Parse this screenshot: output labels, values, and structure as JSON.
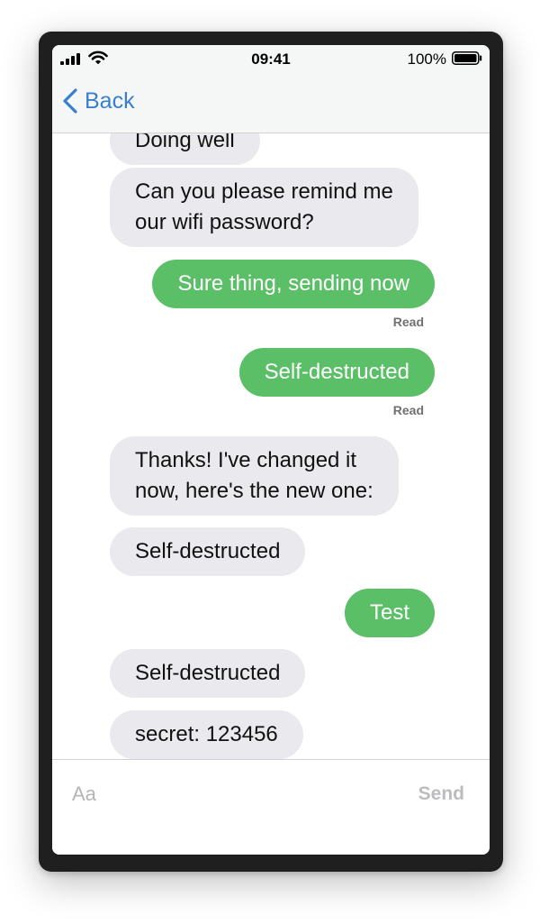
{
  "status_bar": {
    "time": "09:41",
    "battery_percent": "100%",
    "signal_icon": "signal-bars-icon",
    "wifi_icon": "wifi-icon",
    "battery_icon": "battery-icon"
  },
  "nav": {
    "back_label": "Back",
    "back_icon": "chevron-left-icon"
  },
  "messages": [
    {
      "direction": "received",
      "text": "Doing well"
    },
    {
      "direction": "received",
      "text_line1": "Can you please remind me",
      "text_line2": "our wifi password?"
    },
    {
      "direction": "sent",
      "text": "Sure thing, sending now",
      "receipt": "Read"
    },
    {
      "direction": "sent",
      "text": "Self-destructed",
      "receipt": "Read"
    },
    {
      "direction": "received",
      "text_line1": "Thanks! I've changed it",
      "text_line2": "now, here's the new one:"
    },
    {
      "direction": "received",
      "text": "Self-destructed"
    },
    {
      "direction": "sent",
      "text": "Test"
    },
    {
      "direction": "received",
      "text": "Self-destructed"
    },
    {
      "direction": "received",
      "text": "secret: 123456"
    }
  ],
  "composer": {
    "placeholder": "Aa",
    "value": "",
    "send_label": "Send"
  },
  "colors": {
    "sent_bubble": "#5abf67",
    "received_bubble": "#e9e9ee",
    "accent": "#3a7fcf",
    "header_bg": "#f4f7f5"
  }
}
